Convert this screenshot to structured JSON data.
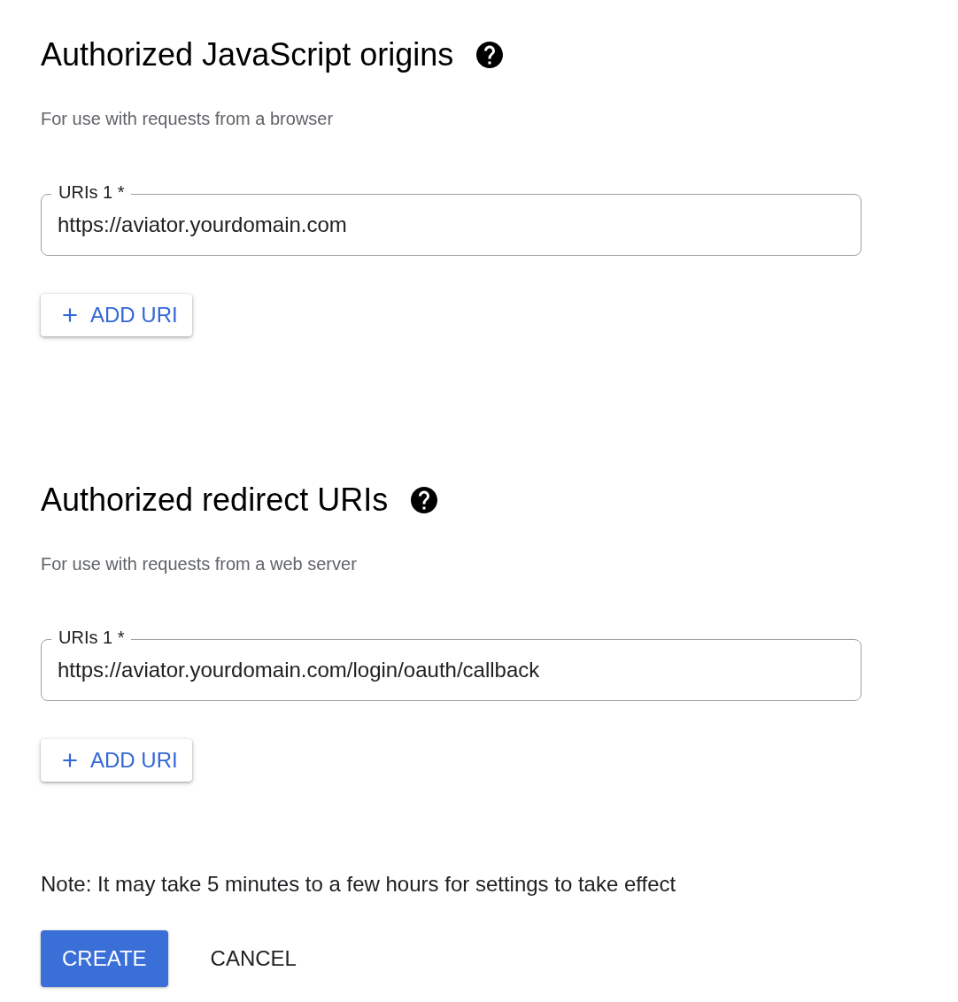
{
  "sections": [
    {
      "title": "Authorized JavaScript origins",
      "subtitle": "For use with requests from a browser",
      "fields": [
        {
          "label": "URIs 1 *",
          "value": "https://aviator.yourdomain.com"
        }
      ],
      "add_button": "ADD URI"
    },
    {
      "title": "Authorized redirect URIs",
      "subtitle": "For use with requests from a web server",
      "fields": [
        {
          "label": "URIs 1 *",
          "value": "https://aviator.yourdomain.com/login/oauth/callback"
        }
      ],
      "add_button": "ADD URI"
    }
  ],
  "note": "Note: It may take 5 minutes to a few hours for settings to take effect",
  "buttons": [
    {
      "label": "CREATE",
      "kind": "primary"
    },
    {
      "label": "CANCEL",
      "kind": "text"
    }
  ]
}
